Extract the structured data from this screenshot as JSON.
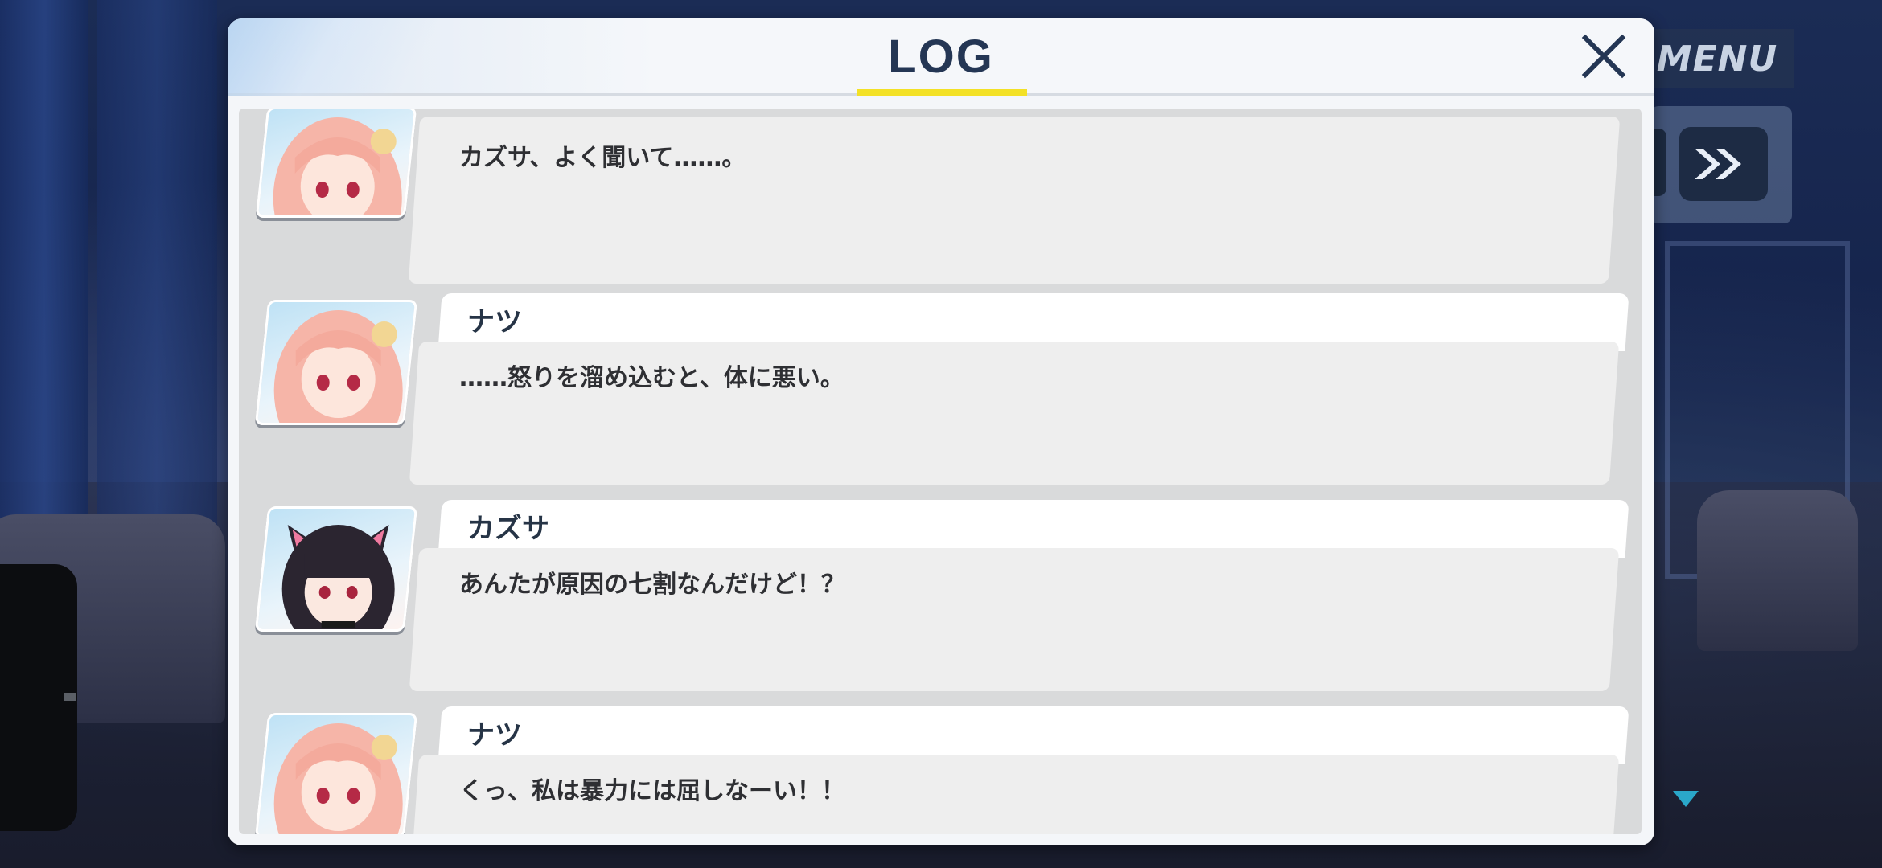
{
  "hud": {
    "menu_label": "MENU",
    "skip_label": "»"
  },
  "log": {
    "title": "LOG",
    "entries": [
      {
        "speaker": "",
        "avatar": "pink-hair-girl",
        "message": "カズサ、よく聞いて……。"
      },
      {
        "speaker": "ナツ",
        "avatar": "pink-hair-girl",
        "message": "……怒りを溜め込むと、体に悪い。"
      },
      {
        "speaker": "カズサ",
        "avatar": "black-hair-cat-ear-girl",
        "message": "あんたが原因の七割なんだけど！？"
      },
      {
        "speaker": "ナツ",
        "avatar": "pink-hair-girl",
        "message": "くっ、私は暴力には屈しなーい！！"
      }
    ]
  },
  "colors": {
    "title": "#243654",
    "title_underline": "#f3e126",
    "scroll_arrow": "#2aa7c9"
  }
}
